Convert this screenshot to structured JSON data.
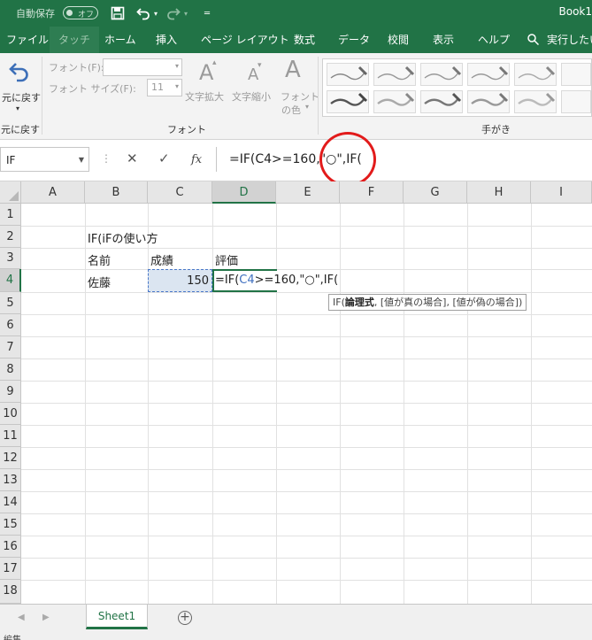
{
  "title_bar": {
    "autosave_label": "自動保存",
    "autosave_toggle": "オフ",
    "book_title": "Book1"
  },
  "menu": {
    "tabs": [
      "ファイル",
      "タッチ",
      "ホーム",
      "挿入",
      "ページ レイアウト",
      "数式",
      "データ",
      "校閲",
      "表示",
      "ヘルプ"
    ],
    "search_label": "実行したい"
  },
  "ribbon": {
    "undo": {
      "label": "元に戻す",
      "group": "元に戻す"
    },
    "font": {
      "font_label": "フォント(F):",
      "size_label": "フォント サイズ(F):",
      "size_value": "11",
      "enlarge_label": "文字拡大",
      "shrink_label": "文字縮小",
      "color_label_1": "フォント",
      "color_label_2": "の色",
      "group": "フォント"
    },
    "ink": {
      "group": "手がき"
    }
  },
  "formula_bar": {
    "name_box": "IF",
    "fx_label": "fx",
    "formula": "=IF(C4>=160,\"○\",IF("
  },
  "grid": {
    "columns": [
      "A",
      "B",
      "C",
      "D",
      "E",
      "F",
      "G",
      "H",
      "I"
    ],
    "rows": [
      "1",
      "2",
      "3",
      "4",
      "5",
      "6",
      "7",
      "8",
      "9",
      "10",
      "11",
      "12",
      "13",
      "14",
      "15",
      "16",
      "17",
      "18"
    ],
    "cells": {
      "B2": "IF(iFの使い方",
      "B3": "名前",
      "C3": "成績",
      "D3": "評価",
      "B4": "佐藤",
      "C4": "150"
    },
    "d4_prefix": "=IF(",
    "d4_ref": "C4",
    "d4_suffix": ">=160,\"○\",IF(",
    "tooltip_fn": "IF(",
    "tooltip_bold": "論理式",
    "tooltip_rest": ", [値が真の場合], [値が偽の場合])"
  },
  "sheets": {
    "tabs": [
      "Sheet1"
    ]
  },
  "status": {
    "mode": "編集"
  },
  "colors": {
    "excel_green": "#217346",
    "selection_fill": "#dbe5f1",
    "annotation_red": "#e21b1b"
  }
}
